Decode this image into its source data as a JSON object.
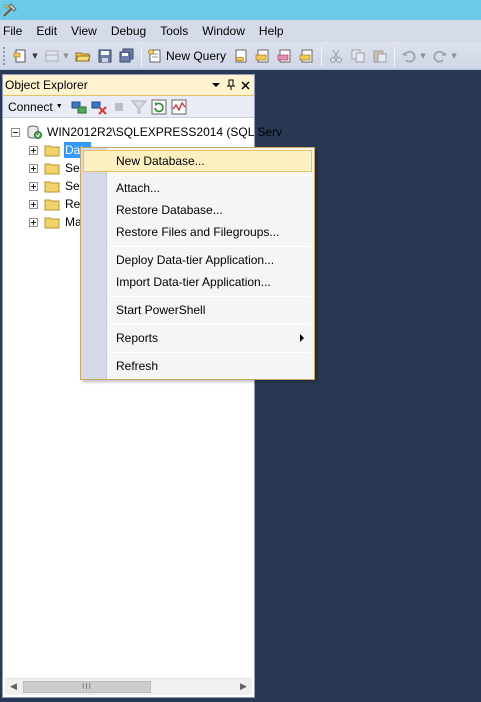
{
  "menubar": {
    "items": [
      "File",
      "Edit",
      "View",
      "Debug",
      "Tools",
      "Window",
      "Help"
    ]
  },
  "toolbar": {
    "new_query_label": "New Query"
  },
  "object_explorer": {
    "title": "Object Explorer",
    "header_buttons": [
      "dropdown-icon",
      "pin-icon",
      "close-icon"
    ],
    "connect_label": "Connect",
    "server_node": "WIN2012R2\\SQLEXPRESS2014 (SQL Serv",
    "children": [
      {
        "label": "Data",
        "icon": "folder-icon",
        "selected": true
      },
      {
        "label": "Se",
        "icon": "folder-icon"
      },
      {
        "label": "Se",
        "icon": "folder-icon"
      },
      {
        "label": "Re",
        "icon": "folder-icon"
      },
      {
        "label": "Ma",
        "icon": "folder-icon"
      }
    ],
    "scroll_thumb_glyph": "III"
  },
  "context_menu": {
    "items": [
      {
        "label": "New Database...",
        "highlighted": true
      },
      {
        "label": "Attach..."
      },
      {
        "label": "Restore Database..."
      },
      {
        "label": "Restore Files and Filegroups..."
      },
      {
        "label": "Deploy Data-tier Application..."
      },
      {
        "label": "Import Data-tier Application..."
      },
      {
        "label": "Start PowerShell"
      },
      {
        "label": "Reports",
        "submenu": true
      },
      {
        "label": "Refresh"
      }
    ]
  },
  "colors": {
    "background": "#293955",
    "menu_highlight": "#fcf0c1",
    "selection": "#3399ff",
    "title_strip": "#6ccbe9"
  }
}
